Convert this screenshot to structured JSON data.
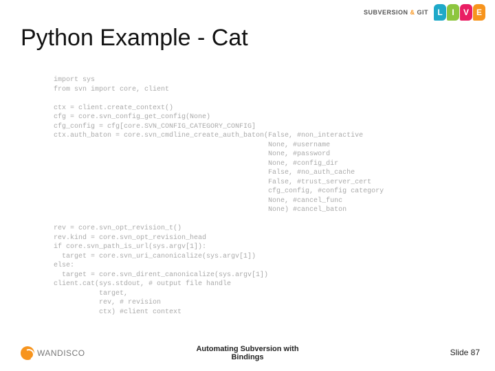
{
  "brand": {
    "svn": "SUBVERSION",
    "amp": "&",
    "git": "GIT"
  },
  "live": {
    "l": "L",
    "i": "I",
    "v": "V",
    "e": "E"
  },
  "title": "Python Example - Cat",
  "code": "import sys\nfrom svn import core, client\n\nctx = client.create_context()\ncfg = core.svn_config_get_config(None)\ncfg_config = cfg[core.SVN_CONFIG_CATEGORY_CONFIG]\nctx.auth_baton = core.svn_cmdline_create_auth_baton(False, #non_interactive\n                                                    None, #username\n                                                    None, #password\n                                                    None, #config_dir\n                                                    False, #no_auth_cache\n                                                    False, #trust_server_cert\n                                                    cfg_config, #config category\n                                                    None, #cancel_func\n                                                    None) #cancel_baton\n\nrev = core.svn_opt_revision_t()\nrev.kind = core.svn_opt_revision_head\nif core.svn_path_is_url(sys.argv[1]):\n  target = core.svn_uri_canonicalize(sys.argv[1])\nelse:\n  target = core.svn_dirent_canonicalize(sys.argv[1])\nclient.cat(sys.stdout, # output file handle\n           target,\n           rev, # revision\n           ctx) #client context",
  "footer": {
    "logo_text": "WANDISCO",
    "center_line1": "Automating Subversion with",
    "center_line2": "Bindings",
    "right": "Slide 87"
  }
}
